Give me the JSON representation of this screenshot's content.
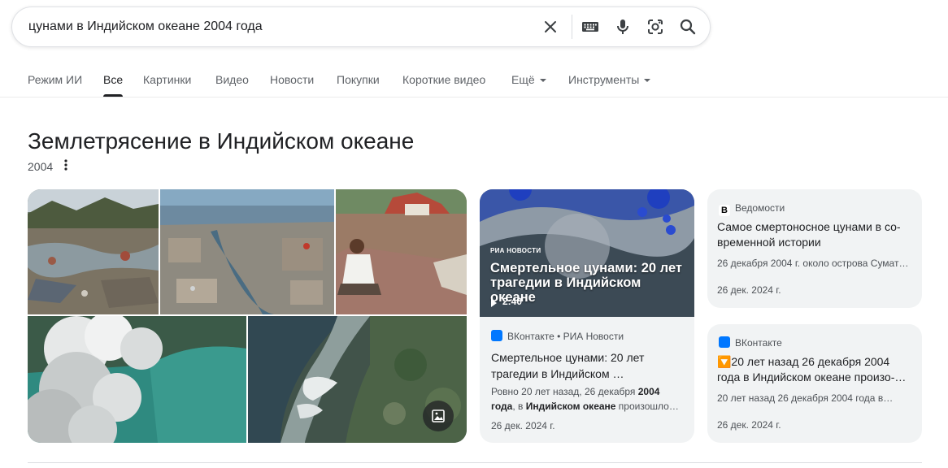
{
  "search": {
    "query": "цунами в Индийском океане 2004 года",
    "icons": [
      "close-icon",
      "keyboard-icon",
      "microphone-icon",
      "lens-icon",
      "search-icon"
    ]
  },
  "tabs": [
    {
      "label": "Режим ИИ",
      "active": false
    },
    {
      "label": "Все",
      "active": true
    },
    {
      "label": "Картинки",
      "active": false
    },
    {
      "label": "Видео",
      "active": false
    },
    {
      "label": "Новости",
      "active": false
    },
    {
      "label": "Покупки",
      "active": false
    },
    {
      "label": "Короткие видео",
      "active": false
    },
    {
      "label": "Ещё",
      "active": false,
      "dropdown": true
    },
    {
      "label": "Инструменты",
      "active": false,
      "dropdown": true
    }
  ],
  "panel": {
    "title": "Землетрясение в Индийском океане",
    "subtitle": "2004"
  },
  "video_card": {
    "thumb_brand": "РИА НОВОСТИ",
    "thumb_title": "Смертельное цунами: 20 лет трагедии в Индийском океане",
    "duration": "2:40",
    "source": "ВКонтакте • РИА Новости",
    "title": "Смертельное цунами: 20 лет трагедии в Индийском …",
    "snippet_1": "Ровно 20 лет назад, 26 декабря ",
    "snippet_bold_1": "2004 года",
    "snippet_2": ", в ",
    "snippet_bold_2": "Индийском океане",
    "snippet_3": " произошло…",
    "date": "26 дек. 2024 г."
  },
  "news_cards": [
    {
      "source": "Ведомости",
      "title": "Самое смертоносное цунами в со-временной истории",
      "snippet": "26 декабря 2004 г. около острова Сумат…",
      "date": "26 дек. 2024 г."
    },
    {
      "source": "ВКонтакте",
      "title": "🔽20 лет назад 26 декабря 2004 года в Индийском океане произо-…",
      "snippet": "20 лет назад 26 декабря 2004 года в…",
      "date": "26 дек. 2024 г."
    }
  ],
  "colors": {
    "accent": "#1a73e8",
    "vk": "#0077ff",
    "card_bg": "#f1f3f4"
  }
}
